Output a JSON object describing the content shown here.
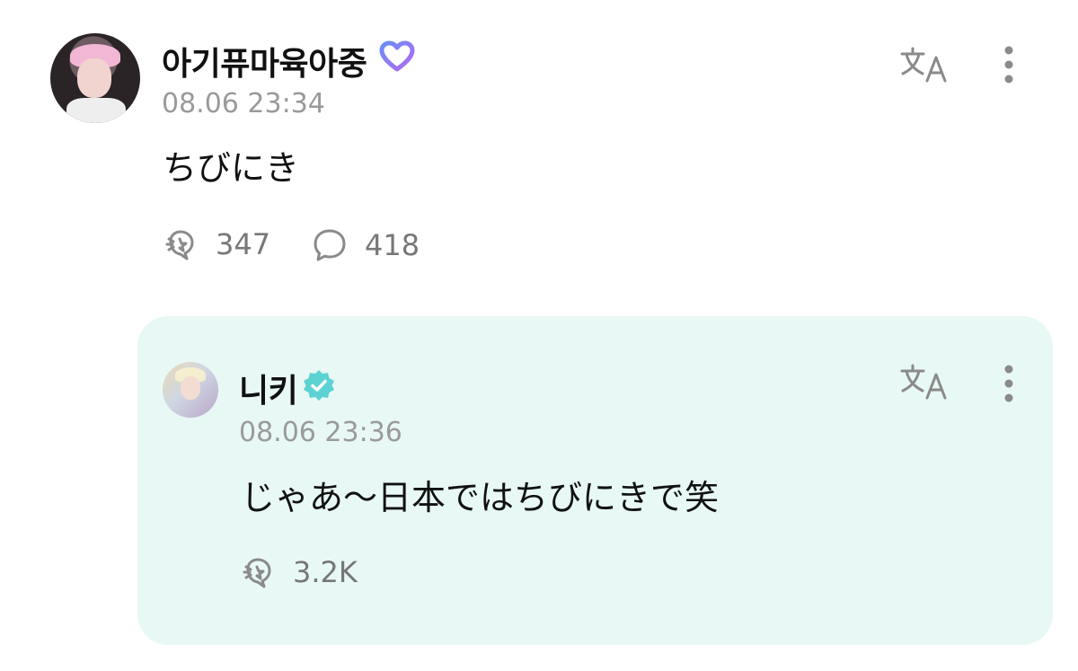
{
  "post": {
    "author": "아기퓨마육아중",
    "timestamp": "08.06 23:34",
    "text": "ちびにき",
    "likes": "347",
    "comments": "418",
    "badge_icon": "heart-badge-icon",
    "badge_color": "#8b6cf0"
  },
  "reply": {
    "author": "니키",
    "timestamp": "08.06 23:36",
    "text": "じゃあ〜日本ではちびにきで笑",
    "likes": "3.2K",
    "badge_icon": "verified-badge-icon",
    "badge_color": "#5cd2d2",
    "card_background": "#e8f8f5"
  },
  "colors": {
    "text": "#111111",
    "meta": "#9a9a9a",
    "icon": "#8a8a8a"
  }
}
